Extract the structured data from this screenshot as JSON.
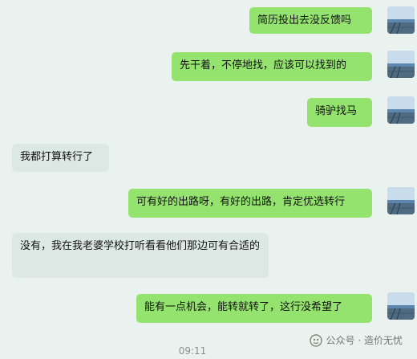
{
  "messages": [
    {
      "side": "out",
      "text": "简历投出去没反馈吗"
    },
    {
      "side": "out",
      "text": "先干着，不停地找，应该可以找到的"
    },
    {
      "side": "out",
      "text": "骑驴找马"
    },
    {
      "side": "in",
      "text": "我都打算转行了"
    },
    {
      "side": "out",
      "text": "可有好的出路呀，有好的出路，肯定优选转行"
    },
    {
      "side": "in",
      "text": "没有，我在我老婆学校打听看看他们那边可有合适的"
    },
    {
      "side": "out",
      "text": "能有一点机会，能转就转了，这行没希望了"
    }
  ],
  "timestamp": "09:11",
  "watermark": "公众号 · 造价无忧",
  "icons": {
    "avatar": "sea-view-avatar-icon",
    "watermark": "wechat-official-account-icon"
  },
  "colors": {
    "background": "#e9f2ee",
    "outgoing_bubble": "#94e36f",
    "incoming_bubble": "#dce8e3"
  }
}
